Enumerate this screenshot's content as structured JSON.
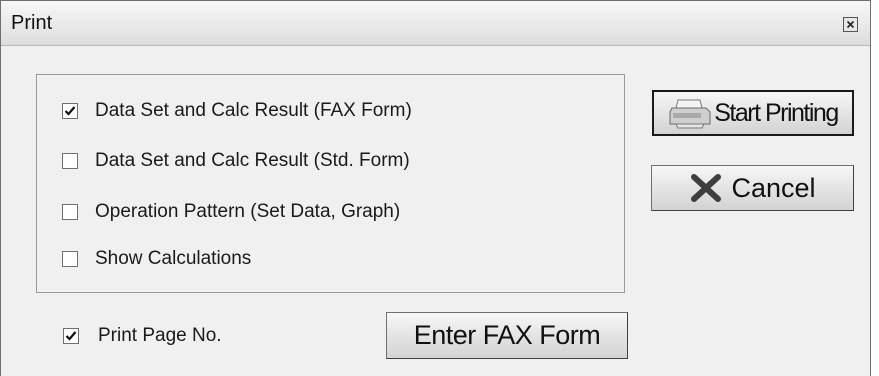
{
  "window": {
    "title": "Print"
  },
  "options": [
    {
      "label": "Data Set and Calc Result (FAX Form)",
      "checked": true
    },
    {
      "label": "Data Set and Calc Result (Std. Form)",
      "checked": false
    },
    {
      "label": "Operation Pattern (Set Data, Graph)",
      "checked": false
    },
    {
      "label": "Show Calculations",
      "checked": false
    }
  ],
  "print_page_no": {
    "label": "Print Page No.",
    "checked": true
  },
  "buttons": {
    "start_printing": "Start Printing",
    "cancel": "Cancel",
    "enter_fax_form": "Enter FAX Form"
  },
  "icons": {
    "close": "close-icon",
    "printer": "printer-icon",
    "cancel": "x-icon",
    "check": "checkmark-icon"
  }
}
